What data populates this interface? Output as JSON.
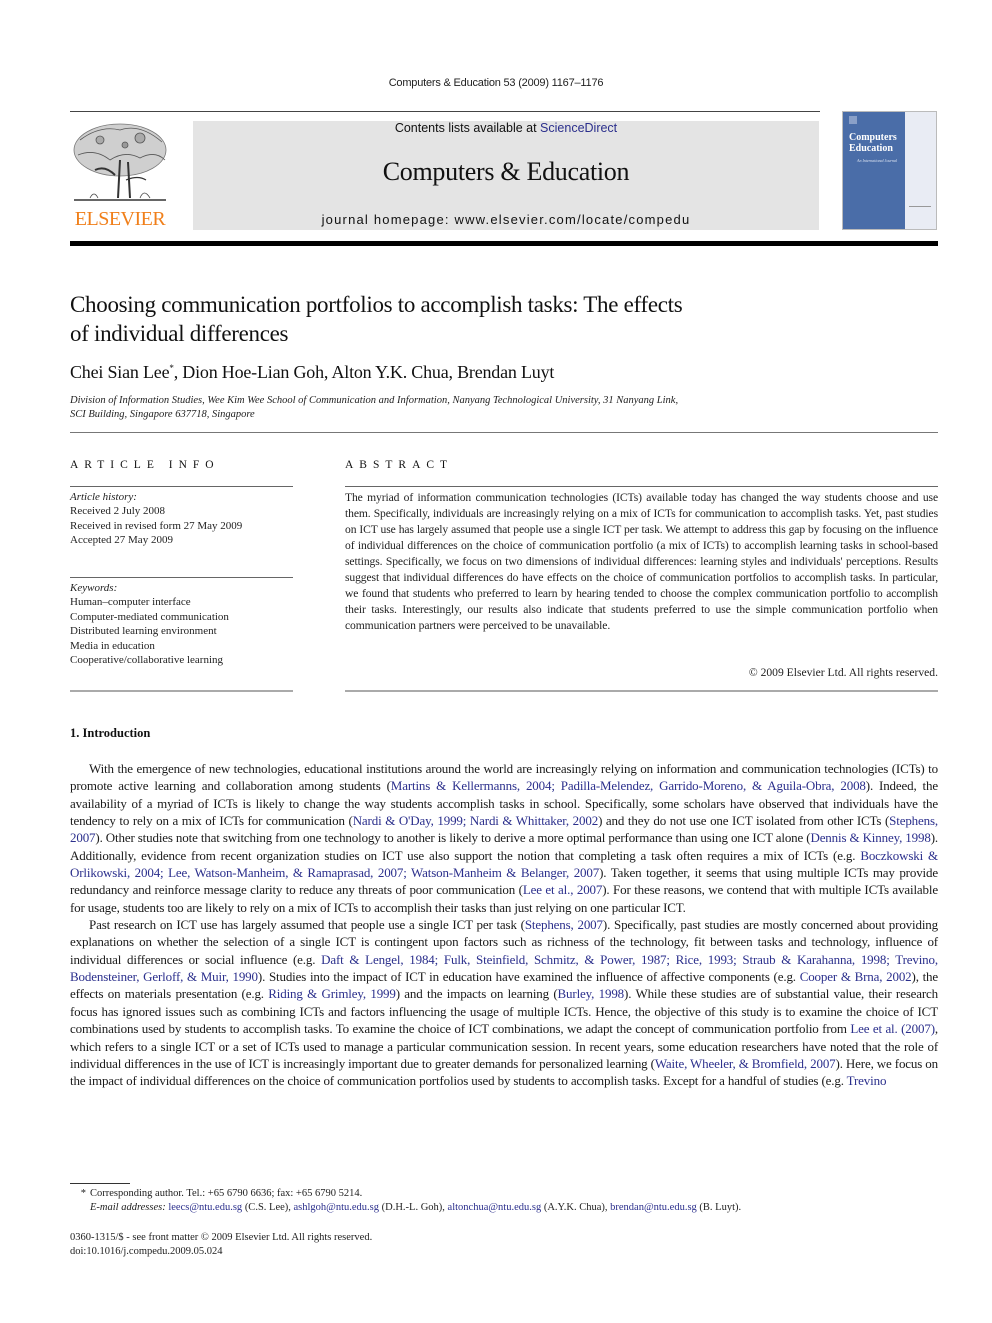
{
  "running_head": "Computers & Education 53 (2009) 1167–1176",
  "masthead": {
    "contents_prefix": "Contents lists available at ",
    "contents_link": "ScienceDirect",
    "journal_title": "Computers & Education",
    "homepage": "journal homepage: www.elsevier.com/locate/compedu"
  },
  "publisher_logo": {
    "wordmark": "ELSEVIER",
    "color": "#f07f1a"
  },
  "cover": {
    "title_line1": "Computers",
    "title_line2": "Education",
    "amp": "&",
    "subtitle": "An International Journal",
    "color": "#4a6da8"
  },
  "article": {
    "title_line1": "Choosing communication portfolios to accomplish tasks: The effects",
    "title_line2": "of individual differences",
    "authors": [
      {
        "name": "Chei Sian Lee",
        "mark": "*"
      },
      {
        "name": "Dion Hoe-Lian Goh",
        "mark": ""
      },
      {
        "name": "Alton Y.K. Chua",
        "mark": ""
      },
      {
        "name": "Brendan Luyt",
        "mark": ""
      }
    ],
    "affiliation_line1": "Division of Information Studies, Wee Kim Wee School of Communication and Information, Nanyang Technological University, 31 Nanyang Link,",
    "affiliation_line2": "SCI Building, Singapore 637718, Singapore"
  },
  "article_info": {
    "heading": "ARTICLE INFO",
    "history_label": "Article history:",
    "history": [
      "Received 2 July 2008",
      "Received in revised form 27 May 2009",
      "Accepted 27 May 2009"
    ],
    "keywords_label": "Keywords:",
    "keywords": [
      "Human–computer interface",
      "Computer-mediated communication",
      "Distributed learning environment",
      "Media in education",
      "Cooperative/collaborative learning"
    ]
  },
  "abstract": {
    "heading": "ABSTRACT",
    "text": "The myriad of information communication technologies (ICTs) available today has changed the way students choose and use them. Specifically, individuals are increasingly relying on a mix of ICTs for communication to accomplish tasks. Yet, past studies on ICT use has largely assumed that people use a single ICT per task. We attempt to address this gap by focusing on the influence of individual differences on the choice of communication portfolio (a mix of ICTs) to accomplish learning tasks in school-based settings. Specifically, we focus on two dimensions of individual differences: learning styles and individuals' perceptions. Results suggest that individual differences do have effects on the choice of communication portfolios to accomplish tasks. In particular, we found that students who preferred to learn by hearing tended to choose the complex communication portfolio to accomplish their tasks. Interestingly, our results also indicate that students preferred to use the simple communication portfolio when communication partners were perceived to be unavailable.",
    "copyright": "© 2009 Elsevier Ltd. All rights reserved."
  },
  "introduction": {
    "heading": "1. Introduction",
    "paragraphs": [
      [
        {
          "t": "With the emergence of new technologies, educational institutions around the world are increasingly relying on information and communication technologies (ICTs) to promote active learning and collaboration among students ("
        },
        {
          "link": "Martins & Kellermanns, 2004; Padilla-Melendez, Garrido-Moreno, & Aguila-Obra, 2008"
        },
        {
          "t": "). Indeed, the availability of a myriad of ICTs is likely to change the way students accomplish tasks in school. Specifically, some scholars have observed that individuals have the tendency to rely on a mix of ICTs for communication ("
        },
        {
          "link": "Nardi & O'Day, 1999; Nardi & Whittaker, 2002"
        },
        {
          "t": ") and they do not use one ICT isolated from other ICTs ("
        },
        {
          "link": "Stephens, 2007"
        },
        {
          "t": "). Other studies note that switching from one technology to another is likely to derive a more optimal performance than using one ICT alone ("
        },
        {
          "link": "Dennis & Kinney, 1998"
        },
        {
          "t": "). Additionally, evidence from recent organization studies on ICT use also support the notion that completing a task often requires a mix of ICTs (e.g. "
        },
        {
          "link": "Boczkowski & Orlikowski, 2004; Lee, Watson-Manheim, & Ramaprasad, 2007; Watson-Manheim & Belanger, 2007"
        },
        {
          "t": "). Taken together, it seems that using multiple ICTs may provide redundancy and reinforce message clarity to reduce any threats of poor communication ("
        },
        {
          "link": "Lee et al., 2007"
        },
        {
          "t": "). For these reasons, we contend that with multiple ICTs available for usage, students too are likely to rely on a mix of ICTs to accomplish their tasks than just relying on one particular ICT."
        }
      ],
      [
        {
          "t": "Past research on ICT use has largely assumed that people use a single ICT per task ("
        },
        {
          "link": "Stephens, 2007"
        },
        {
          "t": "). Specifically, past studies are mostly concerned about providing explanations on whether the selection of a single ICT is contingent upon factors such as richness of the technology, fit between tasks and technology, influence of individual differences or social influence (e.g. "
        },
        {
          "link": "Daft & Lengel, 1984; Fulk, Steinfield, Schmitz, & Power, 1987; Rice, 1993; Straub & Karahanna, 1998; Trevino, Bodensteiner, Gerloff, & Muir, 1990"
        },
        {
          "t": "). Studies into the impact of ICT in education have examined the influence of affective components (e.g. "
        },
        {
          "link": "Cooper & Brna, 2002"
        },
        {
          "t": "), the effects on materials presentation (e.g. "
        },
        {
          "link": "Riding & Grimley, 1999"
        },
        {
          "t": ") and the impacts on learning ("
        },
        {
          "link": "Burley, 1998"
        },
        {
          "t": "). While these studies are of substantial value, their research focus has ignored issues such as combining ICTs and factors influencing the usage of multiple ICTs. Hence, the objective of this study is to examine the choice of ICT combinations used by students to accomplish tasks. To examine the choice of ICT combinations, we adapt the concept of communication portfolio from "
        },
        {
          "link": "Lee et al. (2007)"
        },
        {
          "t": ", which refers to a single ICT or a set of ICTs used to manage a particular communication session. In recent years, some education researchers have noted that the role of individual differences in the use of ICT is increasingly important due to greater demands for personalized learning ("
        },
        {
          "link": "Waite, Wheeler, & Bromfield, 2007"
        },
        {
          "t": "). Here, we focus on the impact of individual differences on the choice of communication portfolios used by students to accomplish tasks. Except for a handful of studies (e.g. "
        },
        {
          "link": "Trevino"
        }
      ]
    ]
  },
  "footnotes": {
    "star": "*",
    "corresponding": "Corresponding author. Tel.: +65 6790 6636; fax: +65 6790 5214.",
    "email_label": "E-mail addresses:",
    "emails": [
      {
        "email": "leecs@ntu.edu.sg",
        "who": " (C.S. Lee), "
      },
      {
        "email": "ashlgoh@ntu.edu.sg",
        "who": " (D.H.-L. Goh), "
      },
      {
        "email": "altonchua@ntu.edu.sg",
        "who": " (A.Y.K. Chua), "
      },
      {
        "email": "brendan@ntu.edu.sg",
        "who": " (B. Luyt)."
      }
    ],
    "issn": "0360-1315/$ - see front matter © 2009 Elsevier Ltd. All rights reserved.",
    "doi": "doi:10.1016/j.compedu.2009.05.024"
  }
}
